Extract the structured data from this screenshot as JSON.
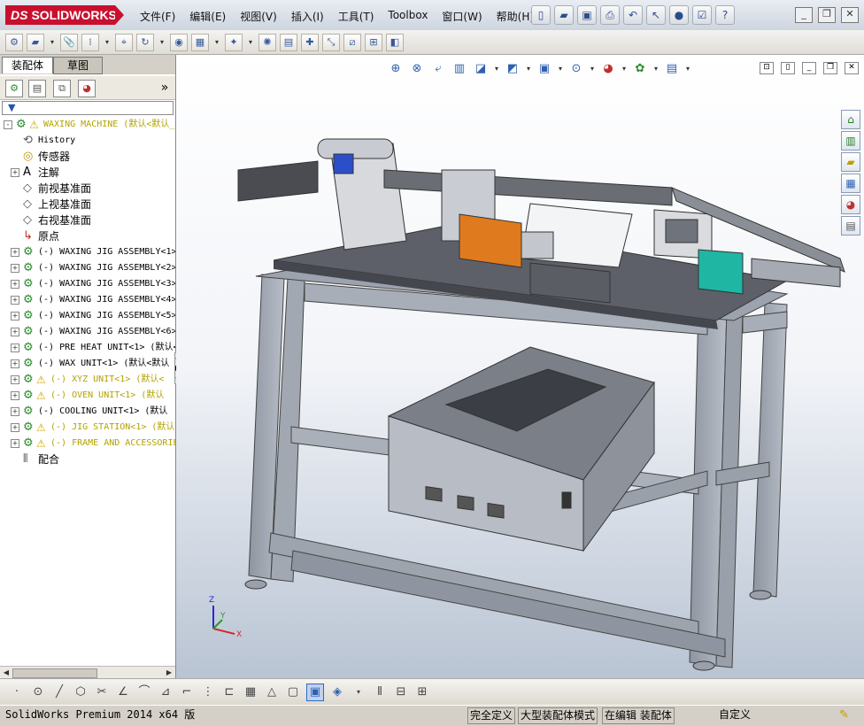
{
  "app": {
    "logo_prefix": "DS",
    "logo_text": "SOLIDWORKS",
    "menus": [
      "文件(F)",
      "编辑(E)",
      "视图(V)",
      "插入(I)",
      "工具(T)",
      "Toolbox",
      "窗口(W)",
      "帮助(H)"
    ]
  },
  "panel": {
    "tabs": [
      "装配体",
      "草图"
    ],
    "filter_label": "▼",
    "expand_label": "»"
  },
  "tree": [
    {
      "label": "WAXING MACHINE  (默认<默认_显",
      "color": "yellow",
      "icon": "assembly-warning",
      "expand": "-",
      "indent": 0
    },
    {
      "label": "History",
      "color": "black",
      "icon": "history",
      "expand": "",
      "indent": 1
    },
    {
      "label": "传感器",
      "color": "black",
      "icon": "sensor",
      "expand": "",
      "indent": 1,
      "cn": true
    },
    {
      "label": "注解",
      "color": "black",
      "icon": "annotation",
      "expand": "+",
      "indent": 1,
      "cn": true
    },
    {
      "label": "前视基准面",
      "color": "black",
      "icon": "plane",
      "expand": "",
      "indent": 1,
      "cn": true
    },
    {
      "label": "上视基准面",
      "color": "black",
      "icon": "plane",
      "expand": "",
      "indent": 1,
      "cn": true
    },
    {
      "label": "右视基准面",
      "color": "black",
      "icon": "plane",
      "expand": "",
      "indent": 1,
      "cn": true
    },
    {
      "label": "原点",
      "color": "black",
      "icon": "origin",
      "expand": "",
      "indent": 1,
      "cn": true
    },
    {
      "label": "(-) WAXING JIG ASSEMBLY<1>",
      "color": "black",
      "icon": "subassembly",
      "expand": "+",
      "indent": 1
    },
    {
      "label": "(-) WAXING JIG ASSEMBLY<2>",
      "color": "black",
      "icon": "subassembly",
      "expand": "+",
      "indent": 1
    },
    {
      "label": "(-) WAXING JIG ASSEMBLY<3>",
      "color": "black",
      "icon": "subassembly",
      "expand": "+",
      "indent": 1
    },
    {
      "label": "(-) WAXING JIG ASSEMBLY<4>",
      "color": "black",
      "icon": "subassembly",
      "expand": "+",
      "indent": 1
    },
    {
      "label": "(-) WAXING JIG ASSEMBLY<5>",
      "color": "black",
      "icon": "subassembly",
      "expand": "+",
      "indent": 1
    },
    {
      "label": "(-) WAXING JIG ASSEMBLY<6>",
      "color": "black",
      "icon": "subassembly",
      "expand": "+",
      "indent": 1
    },
    {
      "label": "(-) PRE HEAT UNIT<1> (默认<",
      "color": "black",
      "icon": "subassembly",
      "expand": "+",
      "indent": 1
    },
    {
      "label": "(-) WAX UNIT<1> (默认<默认",
      "color": "black",
      "icon": "subassembly",
      "expand": "+",
      "indent": 1
    },
    {
      "label": "(-) XYZ UNIT<1> (默认<",
      "color": "yellow",
      "icon": "subassembly-warning",
      "expand": "+",
      "indent": 1
    },
    {
      "label": "(-) OVEN UNIT<1> (默认",
      "color": "yellow",
      "icon": "subassembly-warning",
      "expand": "+",
      "indent": 1
    },
    {
      "label": "(-) COOLING UNIT<1> (默认",
      "color": "black",
      "icon": "subassembly",
      "expand": "+",
      "indent": 1
    },
    {
      "label": "(-) JIG STATION<1> (默认",
      "color": "yellow",
      "icon": "subassembly-warning",
      "expand": "+",
      "indent": 1
    },
    {
      "label": "(-) FRAME AND ACCESSORIES",
      "color": "yellow",
      "icon": "subassembly-warning",
      "expand": "+",
      "indent": 1
    },
    {
      "label": "配合",
      "color": "black",
      "icon": "mates",
      "expand": "",
      "indent": 1,
      "cn": true
    }
  ],
  "triad": {
    "x": "X",
    "y": "Y",
    "z": "Z"
  },
  "status": {
    "product": "SolidWorks Premium 2014 x64 版",
    "fully_defined": "完全定义",
    "large_assembly": "大型装配体模式",
    "editing": "在编辑 装配体",
    "custom": "自定义"
  }
}
